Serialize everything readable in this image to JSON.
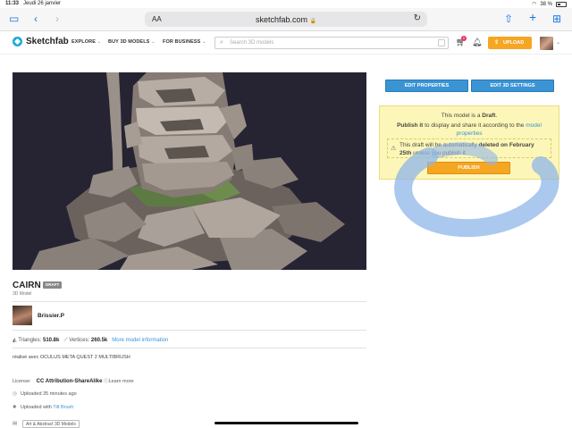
{
  "status_bar": {
    "time": "11:33",
    "date": "Jeudi 26 janvier",
    "battery": "38 %"
  },
  "safari": {
    "text_size_label": "AA",
    "url": "sketchfab.com"
  },
  "header": {
    "brand": "Sketchfab",
    "nav": [
      "EXPLORE",
      "BUY 3D MODELS",
      "FOR BUSINESS"
    ],
    "search_placeholder": "Search 3D models",
    "cart_count": "0",
    "upload_label": "UPLOAD"
  },
  "panel": {
    "edit_properties": "EDIT PROPERTIES",
    "edit_3d_settings": "EDIT 3D SETTINGS",
    "draft_line_prefix": "This model is a ",
    "draft_word": "Draft",
    "publish_it": "Publish it",
    "publish_mid": " to display and share it according to the ",
    "model_properties": "model properties",
    "warn_prefix": "This draft will be automatically ",
    "warn_bold": "deleted on February 25th",
    "warn_suffix": " unless you publish it.",
    "publish_label": "PUBLISH"
  },
  "model": {
    "title": "CAIRN",
    "badge": "DRAFT",
    "subtitle": "3D Model",
    "author": "Brissier.P",
    "triangles_label": "Triangles:",
    "triangles": "510.8k",
    "vertices_label": "Vertices:",
    "vertices": "260.5k",
    "more_info": "More model information",
    "description": "réalisé avec OCULUS META QUEST 2 MULTIBRUSH",
    "license_label": "License:",
    "license": "CC Attribution-ShareAlike",
    "learn_more": "Learn more",
    "uploaded": "Uploaded 35 minutes ago",
    "uploaded_with": "Uploaded with",
    "tool": "Tilt Brush",
    "tag": "Art & Abstract 3D Models"
  },
  "colors": {
    "accent": "#1caad9",
    "blue_button": "#3a94d4",
    "orange": "#f5a623",
    "viewer_bg": "#262433",
    "draft_bg": "#fcf6b8"
  }
}
